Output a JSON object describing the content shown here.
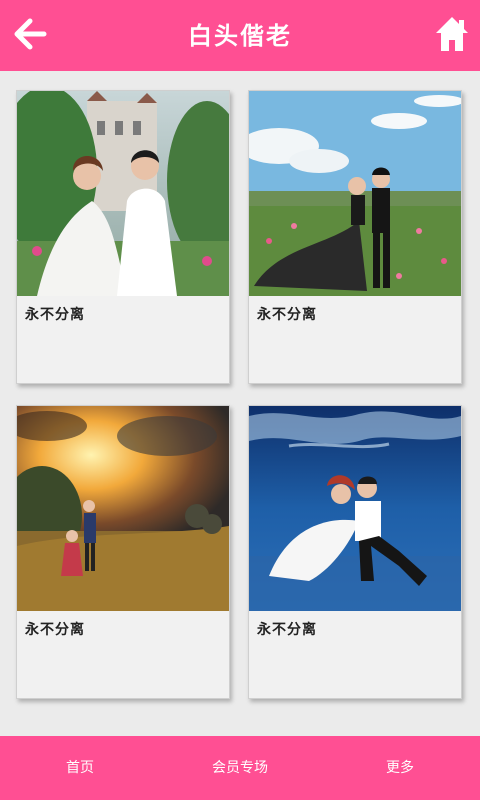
{
  "header": {
    "title": "白头偕老",
    "back_icon": "arrow-left-icon",
    "home_icon": "home-icon",
    "background_color": "#ff4f93"
  },
  "gallery": {
    "items": [
      {
        "caption": "永不分离",
        "scene": "garden-castle"
      },
      {
        "caption": "永不分离",
        "scene": "flower-field"
      },
      {
        "caption": "永不分离",
        "scene": "sunset-meadow"
      },
      {
        "caption": "永不分离",
        "scene": "underwater"
      }
    ]
  },
  "footer": {
    "nav": [
      {
        "label": "首页"
      },
      {
        "label": "会员专场"
      },
      {
        "label": "更多"
      }
    ],
    "background_color": "#ff4f93"
  }
}
